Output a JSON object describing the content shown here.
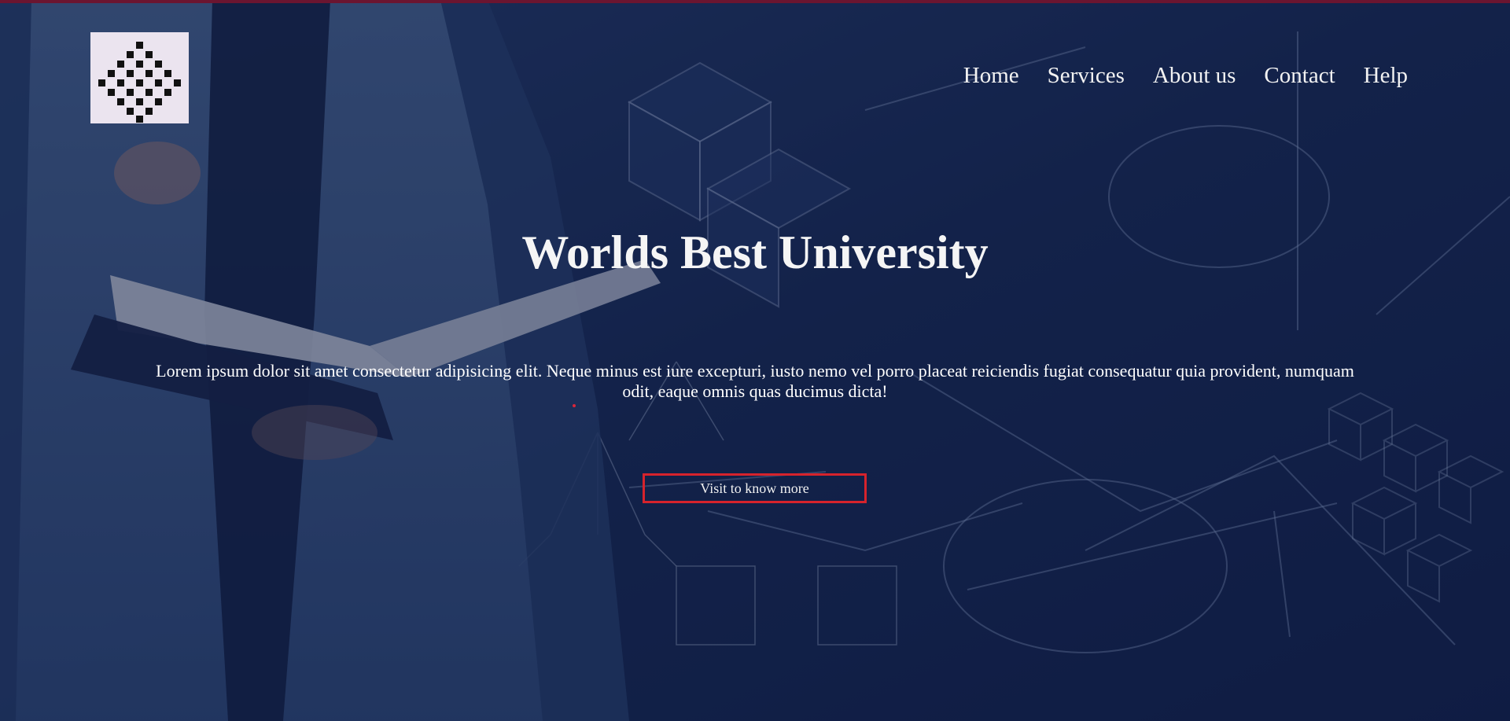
{
  "nav": {
    "items": [
      "Home",
      "Services",
      "About us",
      "Contact",
      "Help"
    ]
  },
  "hero": {
    "title": "Worlds Best University",
    "description": "Lorem ipsum dolor sit amet consectetur adipisicing elit. Neque minus est iure excepturi, iusto nemo vel porro placeat reiciendis fugiat consequatur quia provident, numquam odit, eaque omnis quas ducimus dicta!",
    "button_label": "Visit to know more"
  },
  "colors": {
    "background": "#0f1f3f",
    "top_strip": "#6b1530",
    "button_border": "#d6232c",
    "text": "#f5f5f5"
  },
  "icons": {
    "logo": "diamond-grid-logo-icon"
  }
}
